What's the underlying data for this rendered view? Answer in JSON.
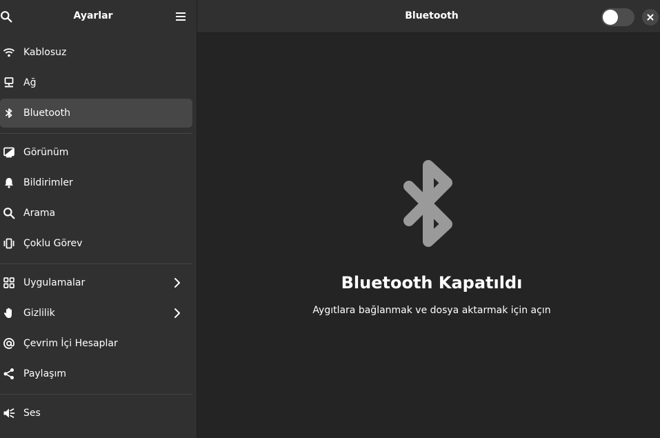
{
  "sidebar": {
    "title": "Ayarlar",
    "search_icon": "search-icon",
    "menu_icon": "hamburger-menu-icon",
    "items": [
      {
        "label": "Kablosuz",
        "icon": "wifi-icon"
      },
      {
        "label": "Ağ",
        "icon": "network-icon"
      },
      {
        "label": "Bluetooth",
        "icon": "bluetooth-icon",
        "active": true
      },
      {
        "label": "Görünüm",
        "icon": "appearance-icon"
      },
      {
        "label": "Bildirimler",
        "icon": "bell-icon"
      },
      {
        "label": "Arama",
        "icon": "search-icon"
      },
      {
        "label": "Çoklu Görev",
        "icon": "multitasking-icon"
      },
      {
        "label": "Uygulamalar",
        "icon": "apps-grid-icon",
        "has_submenu": true
      },
      {
        "label": "Gizlilik",
        "icon": "hand-icon",
        "has_submenu": true
      },
      {
        "label": "Çevrim İçi Hesaplar",
        "icon": "at-sign-icon"
      },
      {
        "label": "Paylaşım",
        "icon": "share-icon"
      },
      {
        "label": "Ses",
        "icon": "speaker-icon"
      }
    ]
  },
  "content": {
    "title": "Bluetooth",
    "toggle_on": false,
    "status": {
      "icon": "bluetooth-icon",
      "title": "Bluetooth Kapatıldı",
      "description": "Aygıtlara bağlanmak ve dosya aktarmak için açın"
    }
  },
  "colors": {
    "sidebar_bg": "#303030",
    "content_bg": "#242424",
    "active_item_bg": "#474747",
    "status_icon": "#9a9a9a"
  }
}
